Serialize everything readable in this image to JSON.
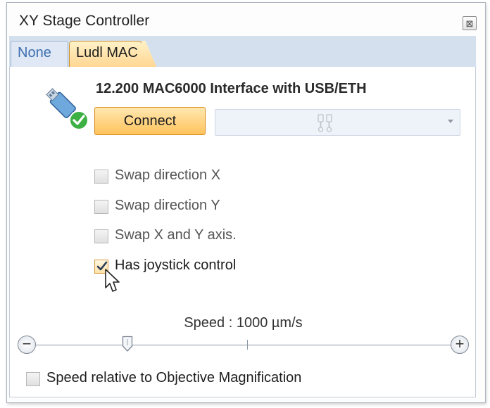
{
  "window": {
    "title": "XY Stage Controller",
    "close_glyph": "⊠"
  },
  "tabs": [
    {
      "label": "None",
      "selected": false
    },
    {
      "label": "Ludl MAC",
      "selected": true
    }
  ],
  "device": {
    "name": "12.200 MAC6000 Interface with USB/ETH",
    "icon": "usb-connected-icon",
    "connect_label": "Connect",
    "port_icon": "usb-plug-icon",
    "port_value": ""
  },
  "options": [
    {
      "label": "Swap direction X",
      "checked": false
    },
    {
      "label": "Swap direction Y",
      "checked": false
    },
    {
      "label": "Swap X and Y axis.",
      "checked": false
    },
    {
      "label": "Has joystick control",
      "checked": true
    }
  ],
  "speed": {
    "label": "Speed : 1000 µm/s",
    "value_um_s": 1000,
    "slider_position_fraction": 0.22,
    "minus_glyph": "−",
    "plus_glyph": "+"
  },
  "speed_relative": {
    "label": "Speed relative to Objective Magnification",
    "checked": false
  },
  "colors": {
    "accent_orange": "#ffc35c",
    "tab_strip": "#d5e0ee",
    "check_ok_green": "#3cb043"
  }
}
